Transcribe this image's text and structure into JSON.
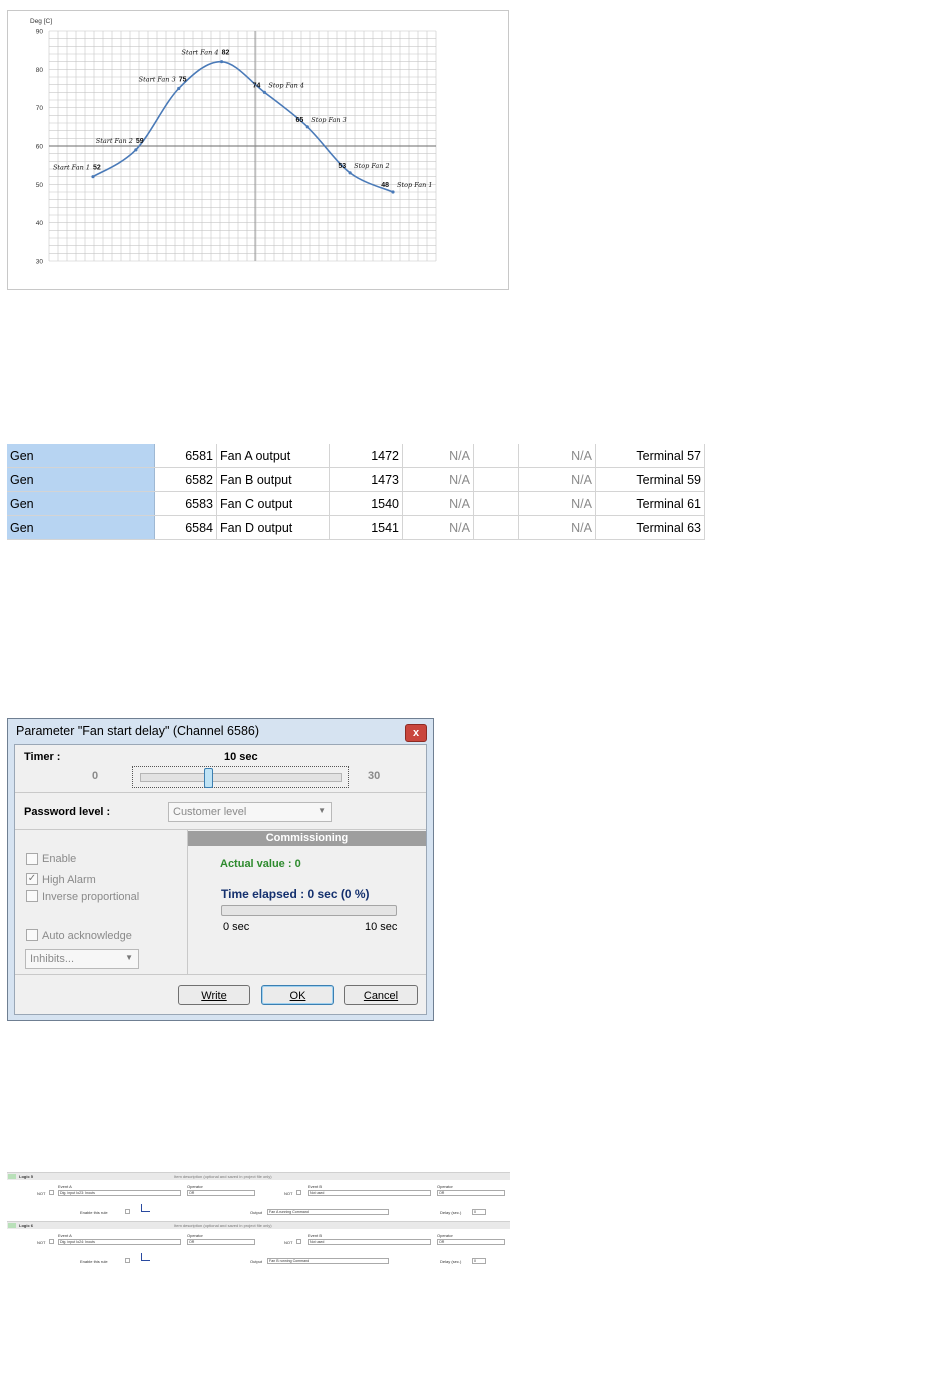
{
  "chart_data": {
    "type": "line",
    "ylabel": "Deg [C]",
    "ylim": [
      30,
      90
    ],
    "yticks": [
      30,
      40,
      50,
      60,
      70,
      80,
      90
    ],
    "grid": true,
    "points": [
      {
        "label": "Start Fan 1",
        "value": 52
      },
      {
        "label": "Start Fan 2",
        "value": 59
      },
      {
        "label": "Start Fan 3",
        "value": 75
      },
      {
        "label": "Start Fan 4",
        "value": 82
      },
      {
        "label": "Stop Fan 4",
        "value": 74
      },
      {
        "label": "Stop Fan 3",
        "value": 65
      },
      {
        "label": "Stop Fan 2",
        "value": 53
      },
      {
        "label": "Stop Fan 1",
        "value": 48
      }
    ],
    "color": "#4a7ab8"
  },
  "table": {
    "rows": [
      [
        "Gen",
        "6581",
        "Fan A output",
        "1472",
        "N/A",
        "",
        "N/A",
        "Terminal 57"
      ],
      [
        "Gen",
        "6582",
        "Fan B output",
        "1473",
        "N/A",
        "",
        "N/A",
        "Terminal 59"
      ],
      [
        "Gen",
        "6583",
        "Fan C output",
        "1540",
        "N/A",
        "",
        "N/A",
        "Terminal 61"
      ],
      [
        "Gen",
        "6584",
        "Fan D output",
        "1541",
        "N/A",
        "",
        "N/A",
        "Terminal 63"
      ]
    ]
  },
  "dialog": {
    "title": "Parameter \"Fan start delay\" (Channel 6586)",
    "close_glyph": "x",
    "timer_label": "Timer :",
    "timer_value": "10 sec",
    "slider_min": "0",
    "slider_max": "30",
    "slider_fraction": 0.333,
    "password_label": "Password level :",
    "password_value": "Customer level",
    "checks": {
      "enable": "Enable",
      "high_alarm": "High Alarm",
      "inverse": "Inverse proportional",
      "auto_ack": "Auto acknowledge"
    },
    "inhibits": "Inhibits...",
    "commissioning": {
      "header": "Commissioning",
      "actual_value": "Actual value : 0",
      "time_elapsed": "Time elapsed : 0 sec (0 %)",
      "progress_fraction": 0,
      "range_start": "0 sec",
      "range_end": "10 sec"
    },
    "buttons": {
      "write": "Write",
      "ok": "OK",
      "cancel": "Cancel"
    }
  },
  "logic": {
    "rules": [
      {
        "name": "Logic 5",
        "description_hint": "Item description (optional and saved in project file only)",
        "event_a_label": "Event A",
        "not_label": "NOT",
        "event_a": "Dig. input Io23: Inouts",
        "operator_label": "Operator",
        "operator": "OR",
        "event_b_label": "Event B",
        "event_b": "Not used",
        "operator2_label": "Operator",
        "operator2": "OR",
        "enable_label": "Enable this rule",
        "output_label": "Output",
        "output": "Fan A running Command",
        "delay_label": "Delay (sec.)",
        "delay": "0"
      },
      {
        "name": "Logic 6",
        "description_hint": "Item description (optional and saved in project file only)",
        "event_a_label": "Event A",
        "not_label": "NOT",
        "event_a": "Dig. input Io24: Inouts",
        "operator_label": "Operator",
        "operator": "OR",
        "event_b_label": "Event B",
        "event_b": "Not used",
        "operator2_label": "Operator",
        "operator2": "OR",
        "enable_label": "Enable this rule",
        "output_label": "Output",
        "output": "Fan B running Command",
        "delay_label": "Delay (sec.)",
        "delay": "0"
      }
    ]
  }
}
